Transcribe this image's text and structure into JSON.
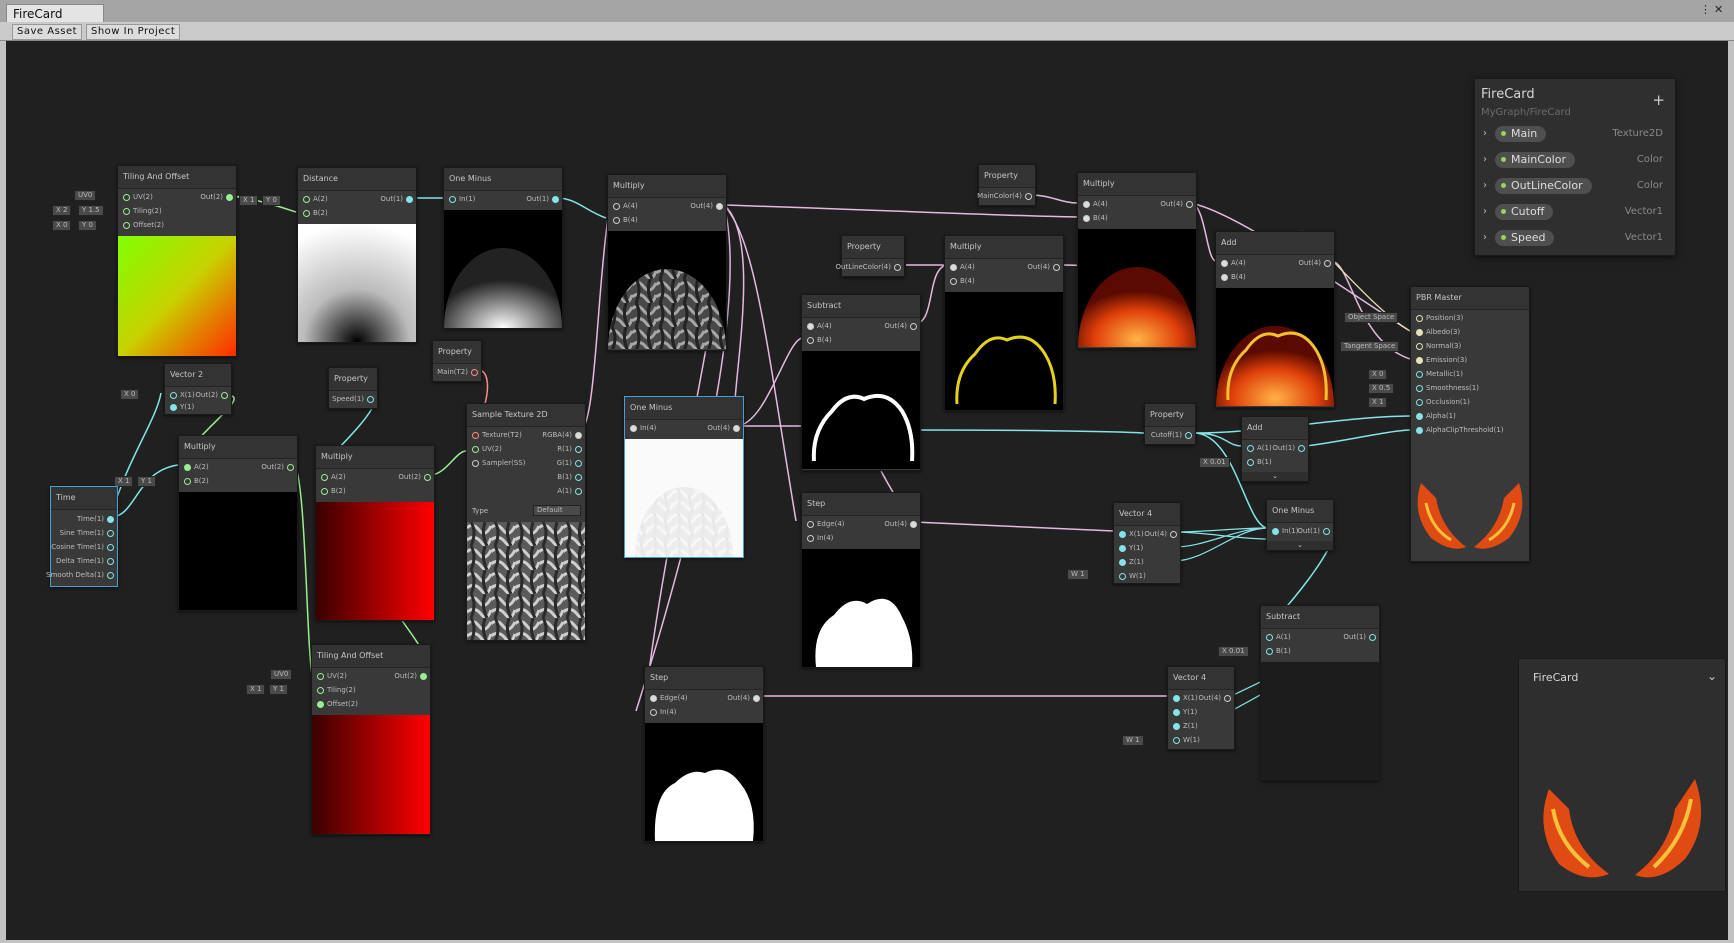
{
  "window": {
    "tab_title": "FireCard"
  },
  "toolbar": {
    "save_asset": "Save Asset",
    "show_in_project": "Show In Project"
  },
  "blackboard": {
    "title": "FireCard",
    "path": "MyGraph/FireCard",
    "add_symbol": "+",
    "properties": [
      {
        "name": "Main",
        "type": "Texture2D"
      },
      {
        "name": "MainColor",
        "type": "Color"
      },
      {
        "name": "OutLineColor",
        "type": "Color"
      },
      {
        "name": "Cutoff",
        "type": "Vector1"
      },
      {
        "name": "Speed",
        "type": "Vector1"
      }
    ]
  },
  "main_preview": {
    "title": "FireCard"
  },
  "nodes": {
    "tiling1": {
      "title": "Tiling And Offset",
      "in": [
        "UV(2)",
        "Tiling(2)",
        "Offset(2)"
      ],
      "out": [
        "Out(2)"
      ],
      "fields": [
        "UV0",
        "X 2",
        "Y 1.5",
        "X 0",
        "Y 0"
      ]
    },
    "distance": {
      "title": "Distance",
      "in": [
        "A(2)",
        "B(2)"
      ],
      "out": [
        "Out(1)"
      ],
      "fields": [
        "X 1",
        "Y 0"
      ]
    },
    "oneminus1": {
      "title": "One Minus",
      "in": [
        "In(1)"
      ],
      "out": [
        "Out(1)"
      ]
    },
    "multiply_noise": {
      "title": "Multiply",
      "in": [
        "A(4)",
        "B(4)"
      ],
      "out": [
        "Out(4)"
      ]
    },
    "vector2": {
      "title": "Vector 2",
      "in": [
        "X(1)",
        "Y(1)"
      ],
      "out": [
        "Out(2)"
      ],
      "fields": [
        "X 0"
      ]
    },
    "property_speed": {
      "title": "Property",
      "out": [
        "Speed(1)"
      ]
    },
    "property_main": {
      "title": "Property",
      "out": [
        "Main(T2)"
      ]
    },
    "multiply_time": {
      "title": "Multiply",
      "in": [
        "A(2)",
        "B(2)"
      ],
      "out": [
        "Out(2)"
      ],
      "fields": [
        "X 1",
        "Y 1"
      ]
    },
    "multiply_red": {
      "title": "Multiply",
      "in": [
        "A(2)",
        "B(2)"
      ],
      "out": [
        "Out(2)"
      ]
    },
    "sample_tex": {
      "title": "Sample Texture 2D",
      "in": [
        "Texture(T2)",
        "UV(2)",
        "Sampler(SS)"
      ],
      "out": [
        "RGBA(4)",
        "R(1)",
        "G(1)",
        "B(1)",
        "A(1)"
      ],
      "type_label": "Type",
      "type_value": "Default"
    },
    "time": {
      "title": "Time",
      "out": [
        "Time(1)",
        "Sine Time(1)",
        "Cosine Time(1)",
        "Delta Time(1)",
        "Smooth Delta(1)"
      ]
    },
    "tiling2": {
      "title": "Tiling And Offset",
      "in": [
        "UV(2)",
        "Tiling(2)",
        "Offset(2)"
      ],
      "out": [
        "Out(2)"
      ],
      "fields": [
        "UV0",
        "X 1",
        "Y 1"
      ]
    },
    "oneminus2": {
      "title": "One Minus",
      "in": [
        "In(4)"
      ],
      "out": [
        "Out(4)"
      ]
    },
    "step1": {
      "title": "Step",
      "in": [
        "Edge(4)",
        "In(4)"
      ],
      "out": [
        "Out(4)"
      ]
    },
    "property_outline": {
      "title": "Property",
      "out": [
        "OutLineColor(4)"
      ]
    },
    "subtract1": {
      "title": "Subtract",
      "in": [
        "A(4)",
        "B(4)"
      ],
      "out": [
        "Out(4)"
      ]
    },
    "step2": {
      "title": "Step",
      "in": [
        "Edge(4)",
        "In(4)"
      ],
      "out": [
        "Out(4)"
      ]
    },
    "multiply_outline": {
      "title": "Multiply",
      "in": [
        "A(4)",
        "B(4)"
      ],
      "out": [
        "Out(4)"
      ]
    },
    "property_maincolor": {
      "title": "Property",
      "out": [
        "MainColor(4)"
      ]
    },
    "multiply_main": {
      "title": "Multiply",
      "in": [
        "A(4)",
        "B(4)"
      ],
      "out": [
        "Out(4)"
      ]
    },
    "add1": {
      "title": "Add",
      "in": [
        "A(4)",
        "B(4)"
      ],
      "out": [
        "Out(4)"
      ]
    },
    "property_cutoff": {
      "title": "Property",
      "out": [
        "Cutoff(1)"
      ]
    },
    "add2": {
      "title": "Add",
      "in": [
        "A(1)",
        "B(1)"
      ],
      "out": [
        "Out(1)"
      ],
      "fields": [
        "X 0.01"
      ]
    },
    "vector4a": {
      "title": "Vector 4",
      "in": [
        "X(1)",
        "Y(1)",
        "Z(1)",
        "W(1)"
      ],
      "out": [
        "Out(4)"
      ],
      "fields": [
        "W 1"
      ]
    },
    "oneminus3": {
      "title": "One Minus",
      "in": [
        "In(1)"
      ],
      "out": [
        "Out(1)"
      ]
    },
    "subtract2": {
      "title": "Subtract",
      "in": [
        "A(1)",
        "B(1)"
      ],
      "out": [
        "Out(1)"
      ],
      "fields": [
        "X 0.01"
      ]
    },
    "vector4b": {
      "title": "Vector 4",
      "in": [
        "X(1)",
        "Y(1)",
        "Z(1)",
        "W(1)"
      ],
      "out": [
        "Out(4)"
      ],
      "fields": [
        "W 1"
      ]
    },
    "pbr": {
      "title": "PBR Master",
      "in": [
        "Position(3)",
        "Albedo(3)",
        "Normal(3)",
        "Emission(3)",
        "Metallic(1)",
        "Smoothness(1)",
        "Occlusion(1)",
        "Alpha(1)",
        "AlphaClipThreshold(1)"
      ],
      "fields": [
        "Object Space",
        "Tangent Space",
        "X 0",
        "X 0.5",
        "X 1"
      ]
    }
  },
  "colors": {
    "canvas": "#202020",
    "node": "#393939",
    "selection": "#44a1d4",
    "vec1": "#84e4e7",
    "vec2": "#9aef92",
    "vec4": "#fbcbf4",
    "texture": "#ff8b8b"
  }
}
